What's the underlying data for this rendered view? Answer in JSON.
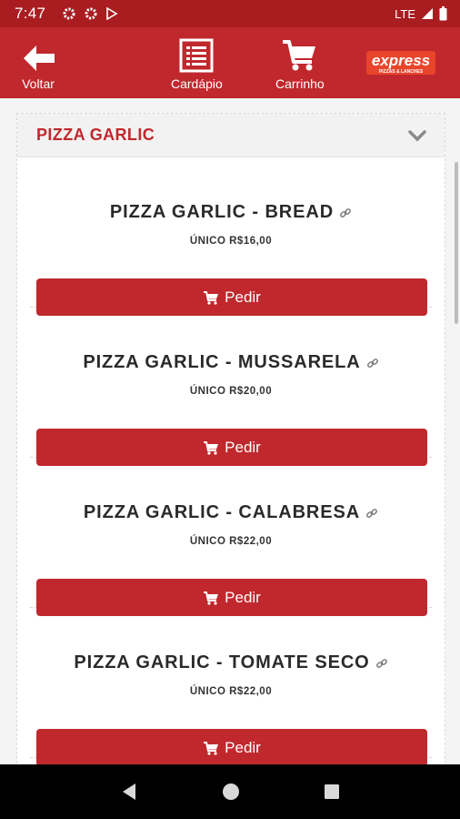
{
  "status_bar": {
    "time": "7:47",
    "network": "LTE",
    "icons": [
      "settings-icon",
      "settings-icon",
      "play-store-icon",
      "signal-icon",
      "battery-icon"
    ]
  },
  "header": {
    "back_label": "Voltar",
    "menu_label": "Cardápio",
    "cart_label": "Carrinho",
    "logo_text": "express",
    "logo_subtext": "PIZZAS & LANCHES"
  },
  "category": {
    "title": "PIZZA GARLIC"
  },
  "items": [
    {
      "name": "PIZZA GARLIC - BREAD",
      "price": "ÚNICO R$16,00",
      "button": "Pedir"
    },
    {
      "name": "PIZZA GARLIC - MUSSARELA",
      "price": "ÚNICO R$20,00",
      "button": "Pedir"
    },
    {
      "name": "PIZZA GARLIC - CALABRESA",
      "price": "ÚNICO R$22,00",
      "button": "Pedir"
    },
    {
      "name": "PIZZA GARLIC - TOMATE SECO",
      "price": "ÚNICO R$22,00",
      "button": "Pedir"
    }
  ],
  "colors": {
    "brand": "#c0282d",
    "status_bar": "#a91d21",
    "background": "#f4f4f4"
  }
}
